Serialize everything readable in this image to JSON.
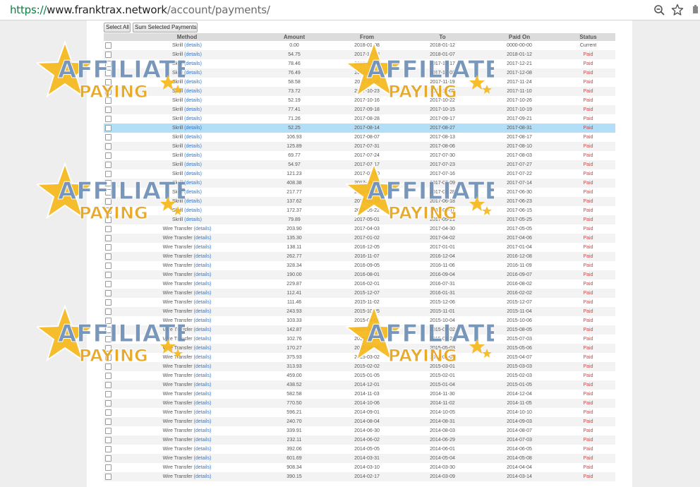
{
  "browser": {
    "url_scheme": "https://",
    "url_host": "www.franktrax.network",
    "url_path": "/account/payments/"
  },
  "toolbar": {
    "select_all_label": "Select All",
    "sum_selected_label": "Sum Selected Payments"
  },
  "table": {
    "columns": [
      "Method",
      "Amount",
      "From",
      "To",
      "Paid On",
      "Status"
    ],
    "details_label": "(details)",
    "rows": [
      [
        "Skrill",
        "0.00",
        "2018-01-08",
        "2018-01-12",
        "0000-00-00",
        "Current"
      ],
      [
        "Skrill",
        "54.75",
        "2017-12-18",
        "2018-01-07",
        "2018-01-12",
        "Paid"
      ],
      [
        "Skrill",
        "78.46",
        "2017-12-04",
        "2017-12-17",
        "2017-12-21",
        "Paid"
      ],
      [
        "Skrill",
        "76.49",
        "2017-11-20",
        "2017-12-03",
        "2017-12-08",
        "Paid"
      ],
      [
        "Skrill",
        "58.58",
        "2017-11-06",
        "2017-11-19",
        "2017-11-24",
        "Paid"
      ],
      [
        "Skrill",
        "73.72",
        "2017-10-23",
        "2017-11-05",
        "2017-11-10",
        "Paid"
      ],
      [
        "Skrill",
        "52.19",
        "2017-10-16",
        "2017-10-22",
        "2017-10-26",
        "Paid"
      ],
      [
        "Skrill",
        "77.41",
        "2017-09-18",
        "2017-10-15",
        "2017-10-19",
        "Paid"
      ],
      [
        "Skrill",
        "71.26",
        "2017-08-28",
        "2017-09-17",
        "2017-09-21",
        "Paid"
      ],
      [
        "Skrill",
        "52.25",
        "2017-08-14",
        "2017-08-27",
        "2017-08-31",
        "Paid"
      ],
      [
        "Skrill",
        "106.93",
        "2017-08-07",
        "2017-08-13",
        "2017-08-17",
        "Paid"
      ],
      [
        "Skrill",
        "125.89",
        "2017-07-31",
        "2017-08-06",
        "2017-08-10",
        "Paid"
      ],
      [
        "Skrill",
        "69.77",
        "2017-07-24",
        "2017-07-30",
        "2017-08-03",
        "Paid"
      ],
      [
        "Skrill",
        "54.97",
        "2017-07-17",
        "2017-07-23",
        "2017-07-27",
        "Paid"
      ],
      [
        "Skrill",
        "121.23",
        "2017-07-10",
        "2017-07-16",
        "2017-07-22",
        "Paid"
      ],
      [
        "Skrill",
        "408.38",
        "2017-06-29",
        "2017-07-09",
        "2017-07-14",
        "Paid"
      ],
      [
        "Skrill",
        "217.77",
        "2017-06-19",
        "2017-06-28",
        "2017-06-30",
        "Paid"
      ],
      [
        "Skrill",
        "137.62",
        "2017-06-12",
        "2017-06-18",
        "2017-06-23",
        "Paid"
      ],
      [
        "Skrill",
        "172.37",
        "2017-05-22",
        "2017-06-11",
        "2017-06-15",
        "Paid"
      ],
      [
        "Skrill",
        "79.89",
        "2017-05-01",
        "2017-05-21",
        "2017-05-25",
        "Paid"
      ],
      [
        "Wire Transfer",
        "203.90",
        "2017-04-03",
        "2017-04-30",
        "2017-05-05",
        "Paid"
      ],
      [
        "Wire Transfer",
        "135.30",
        "2017-01-02",
        "2017-04-02",
        "2017-04-06",
        "Paid"
      ],
      [
        "Wire Transfer",
        "138.11",
        "2016-12-05",
        "2017-01-01",
        "2017-01-04",
        "Paid"
      ],
      [
        "Wire Transfer",
        "262.77",
        "2016-11-07",
        "2016-12-04",
        "2016-12-08",
        "Paid"
      ],
      [
        "Wire Transfer",
        "328.34",
        "2016-09-05",
        "2016-11-06",
        "2016-11-09",
        "Paid"
      ],
      [
        "Wire Transfer",
        "190.00",
        "2016-08-01",
        "2016-09-04",
        "2016-09-07",
        "Paid"
      ],
      [
        "Wire Transfer",
        "229.87",
        "2016-02-01",
        "2016-07-31",
        "2016-08-02",
        "Paid"
      ],
      [
        "Wire Transfer",
        "112.41",
        "2015-12-07",
        "2016-01-31",
        "2016-02-02",
        "Paid"
      ],
      [
        "Wire Transfer",
        "111.46",
        "2015-11-02",
        "2015-12-06",
        "2015-12-07",
        "Paid"
      ],
      [
        "Wire Transfer",
        "243.93",
        "2015-10-05",
        "2015-11-01",
        "2015-11-04",
        "Paid"
      ],
      [
        "Wire Transfer",
        "103.33",
        "2015-08-04",
        "2015-10-04",
        "2015-10-06",
        "Paid"
      ],
      [
        "Wire Transfer",
        "142.87",
        "2015-06-29",
        "2015-08-02",
        "2015-08-05",
        "Paid"
      ],
      [
        "Wire Transfer",
        "102.76",
        "2015-05-04",
        "2015-06-28",
        "2015-07-03",
        "Paid"
      ],
      [
        "Wire Transfer",
        "170.27",
        "2015-04-06",
        "2015-05-03",
        "2015-05-06",
        "Paid"
      ],
      [
        "Wire Transfer",
        "375.93",
        "2015-03-02",
        "2015-04-05",
        "2015-04-07",
        "Paid"
      ],
      [
        "Wire Transfer",
        "313.93",
        "2015-02-02",
        "2015-03-01",
        "2015-03-03",
        "Paid"
      ],
      [
        "Wire Transfer",
        "459.00",
        "2015-01-05",
        "2015-02-01",
        "2015-02-03",
        "Paid"
      ],
      [
        "Wire Transfer",
        "438.52",
        "2014-12-01",
        "2015-01-04",
        "2015-01-05",
        "Paid"
      ],
      [
        "Wire Transfer",
        "582.58",
        "2014-11-03",
        "2014-11-30",
        "2014-12-04",
        "Paid"
      ],
      [
        "Wire Transfer",
        "770.50",
        "2014-10-06",
        "2014-11-02",
        "2014-11-05",
        "Paid"
      ],
      [
        "Wire Transfer",
        "596.21",
        "2014-09-01",
        "2014-10-05",
        "2014-10-10",
        "Paid"
      ],
      [
        "Wire Transfer",
        "240.70",
        "2014-08-04",
        "2014-08-31",
        "2014-09-03",
        "Paid"
      ],
      [
        "Wire Transfer",
        "339.91",
        "2014-06-30",
        "2014-08-03",
        "2014-08-07",
        "Paid"
      ],
      [
        "Wire Transfer",
        "232.11",
        "2014-06-02",
        "2014-06-29",
        "2014-07-03",
        "Paid"
      ],
      [
        "Wire Transfer",
        "392.06",
        "2014-05-05",
        "2014-06-01",
        "2014-06-05",
        "Paid"
      ],
      [
        "Wire Transfer",
        "601.69",
        "2014-03-31",
        "2014-05-04",
        "2014-05-08",
        "Paid"
      ],
      [
        "Wire Transfer",
        "908.34",
        "2014-03-10",
        "2014-03-30",
        "2014-04-04",
        "Paid"
      ],
      [
        "Wire Transfer",
        "390.15",
        "2014-02-17",
        "2014-03-09",
        "2014-03-14",
        "Paid"
      ]
    ],
    "highlighted_row": 9
  },
  "watermark": {
    "line1": "AFFILIATE",
    "line2": "PAYING",
    "colors": {
      "star": "#f6b81c",
      "text_blue": "#6d8fb5",
      "text_gold": "#e8a317"
    }
  },
  "colors": {
    "paid": "#e53a3a",
    "details_link": "#3a78c8",
    "row_highlight": "#b3def7",
    "header_bg": "#dcdcdc"
  }
}
